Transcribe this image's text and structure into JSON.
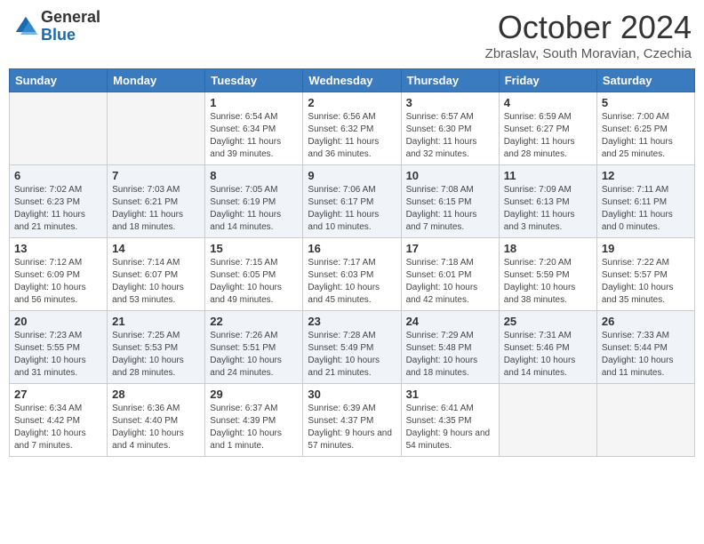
{
  "header": {
    "logo_general": "General",
    "logo_blue": "Blue",
    "month_title": "October 2024",
    "location": "Zbraslav, South Moravian, Czechia"
  },
  "weekdays": [
    "Sunday",
    "Monday",
    "Tuesday",
    "Wednesday",
    "Thursday",
    "Friday",
    "Saturday"
  ],
  "weeks": [
    [
      {
        "day": "",
        "info": ""
      },
      {
        "day": "",
        "info": ""
      },
      {
        "day": "1",
        "info": "Sunrise: 6:54 AM\nSunset: 6:34 PM\nDaylight: 11 hours and 39 minutes."
      },
      {
        "day": "2",
        "info": "Sunrise: 6:56 AM\nSunset: 6:32 PM\nDaylight: 11 hours and 36 minutes."
      },
      {
        "day": "3",
        "info": "Sunrise: 6:57 AM\nSunset: 6:30 PM\nDaylight: 11 hours and 32 minutes."
      },
      {
        "day": "4",
        "info": "Sunrise: 6:59 AM\nSunset: 6:27 PM\nDaylight: 11 hours and 28 minutes."
      },
      {
        "day": "5",
        "info": "Sunrise: 7:00 AM\nSunset: 6:25 PM\nDaylight: 11 hours and 25 minutes."
      }
    ],
    [
      {
        "day": "6",
        "info": "Sunrise: 7:02 AM\nSunset: 6:23 PM\nDaylight: 11 hours and 21 minutes."
      },
      {
        "day": "7",
        "info": "Sunrise: 7:03 AM\nSunset: 6:21 PM\nDaylight: 11 hours and 18 minutes."
      },
      {
        "day": "8",
        "info": "Sunrise: 7:05 AM\nSunset: 6:19 PM\nDaylight: 11 hours and 14 minutes."
      },
      {
        "day": "9",
        "info": "Sunrise: 7:06 AM\nSunset: 6:17 PM\nDaylight: 11 hours and 10 minutes."
      },
      {
        "day": "10",
        "info": "Sunrise: 7:08 AM\nSunset: 6:15 PM\nDaylight: 11 hours and 7 minutes."
      },
      {
        "day": "11",
        "info": "Sunrise: 7:09 AM\nSunset: 6:13 PM\nDaylight: 11 hours and 3 minutes."
      },
      {
        "day": "12",
        "info": "Sunrise: 7:11 AM\nSunset: 6:11 PM\nDaylight: 11 hours and 0 minutes."
      }
    ],
    [
      {
        "day": "13",
        "info": "Sunrise: 7:12 AM\nSunset: 6:09 PM\nDaylight: 10 hours and 56 minutes."
      },
      {
        "day": "14",
        "info": "Sunrise: 7:14 AM\nSunset: 6:07 PM\nDaylight: 10 hours and 53 minutes."
      },
      {
        "day": "15",
        "info": "Sunrise: 7:15 AM\nSunset: 6:05 PM\nDaylight: 10 hours and 49 minutes."
      },
      {
        "day": "16",
        "info": "Sunrise: 7:17 AM\nSunset: 6:03 PM\nDaylight: 10 hours and 45 minutes."
      },
      {
        "day": "17",
        "info": "Sunrise: 7:18 AM\nSunset: 6:01 PM\nDaylight: 10 hours and 42 minutes."
      },
      {
        "day": "18",
        "info": "Sunrise: 7:20 AM\nSunset: 5:59 PM\nDaylight: 10 hours and 38 minutes."
      },
      {
        "day": "19",
        "info": "Sunrise: 7:22 AM\nSunset: 5:57 PM\nDaylight: 10 hours and 35 minutes."
      }
    ],
    [
      {
        "day": "20",
        "info": "Sunrise: 7:23 AM\nSunset: 5:55 PM\nDaylight: 10 hours and 31 minutes."
      },
      {
        "day": "21",
        "info": "Sunrise: 7:25 AM\nSunset: 5:53 PM\nDaylight: 10 hours and 28 minutes."
      },
      {
        "day": "22",
        "info": "Sunrise: 7:26 AM\nSunset: 5:51 PM\nDaylight: 10 hours and 24 minutes."
      },
      {
        "day": "23",
        "info": "Sunrise: 7:28 AM\nSunset: 5:49 PM\nDaylight: 10 hours and 21 minutes."
      },
      {
        "day": "24",
        "info": "Sunrise: 7:29 AM\nSunset: 5:48 PM\nDaylight: 10 hours and 18 minutes."
      },
      {
        "day": "25",
        "info": "Sunrise: 7:31 AM\nSunset: 5:46 PM\nDaylight: 10 hours and 14 minutes."
      },
      {
        "day": "26",
        "info": "Sunrise: 7:33 AM\nSunset: 5:44 PM\nDaylight: 10 hours and 11 minutes."
      }
    ],
    [
      {
        "day": "27",
        "info": "Sunrise: 6:34 AM\nSunset: 4:42 PM\nDaylight: 10 hours and 7 minutes."
      },
      {
        "day": "28",
        "info": "Sunrise: 6:36 AM\nSunset: 4:40 PM\nDaylight: 10 hours and 4 minutes."
      },
      {
        "day": "29",
        "info": "Sunrise: 6:37 AM\nSunset: 4:39 PM\nDaylight: 10 hours and 1 minute."
      },
      {
        "day": "30",
        "info": "Sunrise: 6:39 AM\nSunset: 4:37 PM\nDaylight: 9 hours and 57 minutes."
      },
      {
        "day": "31",
        "info": "Sunrise: 6:41 AM\nSunset: 4:35 PM\nDaylight: 9 hours and 54 minutes."
      },
      {
        "day": "",
        "info": ""
      },
      {
        "day": "",
        "info": ""
      }
    ]
  ]
}
